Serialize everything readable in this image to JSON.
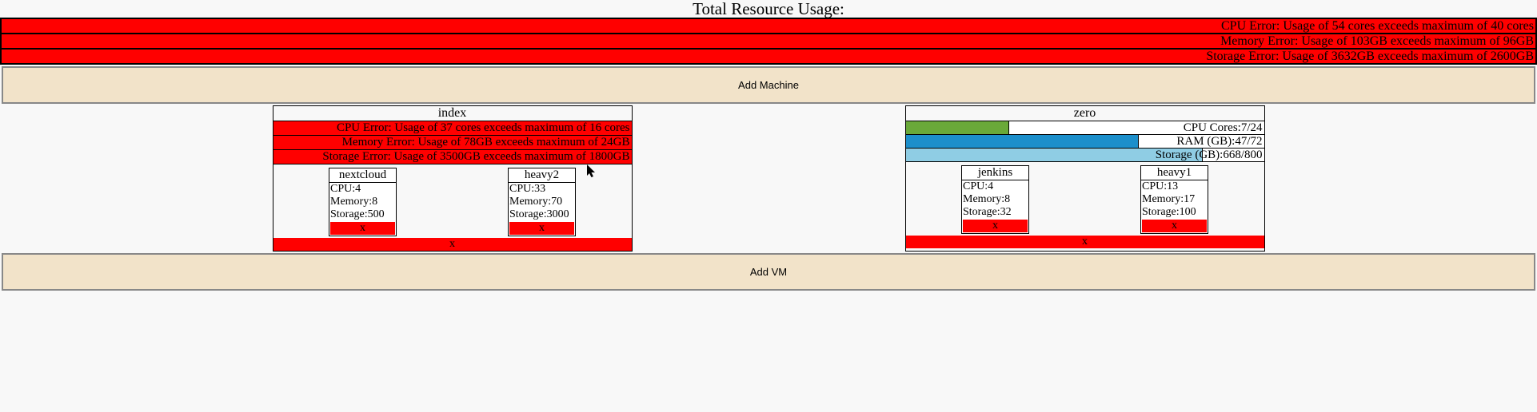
{
  "title": "Total Resource Usage:",
  "global_errors": [
    "CPU Error: Usage of 54 cores exceeds maximum of 40 cores",
    "Memory Error: Usage of 103GB exceeds maximum of 96GB",
    "Storage Error: Usage of 3632GB exceeds maximum of 2600GB"
  ],
  "add_machine_label": "Add Machine",
  "add_vm_label": "Add VM",
  "delete_label": "x",
  "machines": [
    {
      "name": "index",
      "errors": [
        "CPU Error: Usage of 37 cores exceeds maximum of 16 cores",
        "Memory Error: Usage of 78GB exceeds maximum of 24GB",
        "Storage Error: Usage of 3500GB exceeds maximum of 1800GB"
      ],
      "bars": [],
      "vms": [
        {
          "name": "nextcloud",
          "cpu": "CPU:4",
          "mem": "Memory:8",
          "storage": "Storage:500"
        },
        {
          "name": "heavy2",
          "cpu": "CPU:33",
          "mem": "Memory:70",
          "storage": "Storage:3000"
        }
      ]
    },
    {
      "name": "zero",
      "errors": [],
      "bars": [
        {
          "label": "CPU Cores:7/24",
          "pct": 29,
          "color": "#6aa939"
        },
        {
          "label": "RAM (GB):47/72",
          "pct": 65,
          "color": "#1c8fcb"
        },
        {
          "label": "Storage (GB):668/800",
          "pct": 83,
          "color": "#8fcde4"
        }
      ],
      "vms": [
        {
          "name": "jenkins",
          "cpu": "CPU:4",
          "mem": "Memory:8",
          "storage": "Storage:32"
        },
        {
          "name": "heavy1",
          "cpu": "CPU:13",
          "mem": "Memory:17",
          "storage": "Storage:100"
        }
      ]
    }
  ]
}
